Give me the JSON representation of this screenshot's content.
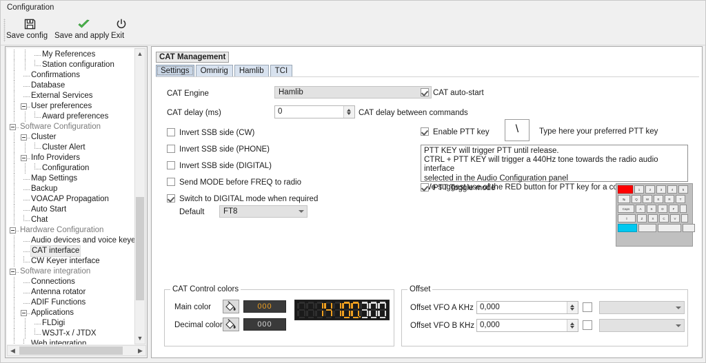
{
  "window": {
    "title": "Configuration"
  },
  "toolbar": {
    "save_config": "Save config",
    "save_and_apply": "Save and apply",
    "exit": "Exit"
  },
  "sidebar": {
    "items": [
      {
        "label": "My References",
        "depth": 3,
        "type": "leaf",
        "selected": false
      },
      {
        "label": "Station configuration",
        "depth": 3,
        "type": "last",
        "selected": false
      },
      {
        "label": "Confirmations",
        "depth": 2,
        "type": "leaf",
        "selected": false
      },
      {
        "label": "Database",
        "depth": 2,
        "type": "leaf",
        "selected": false
      },
      {
        "label": "External Services",
        "depth": 2,
        "type": "leaf",
        "selected": false
      },
      {
        "label": "User preferences",
        "depth": 2,
        "type": "exp",
        "selected": false
      },
      {
        "label": "Award preferences",
        "depth": 3,
        "type": "last",
        "selected": false
      },
      {
        "label": "Software Configuration",
        "depth": 1,
        "type": "exp",
        "selected": false,
        "group": true
      },
      {
        "label": "Cluster",
        "depth": 2,
        "type": "exp",
        "selected": false
      },
      {
        "label": "Cluster Alert",
        "depth": 3,
        "type": "last",
        "selected": false
      },
      {
        "label": "Info Providers",
        "depth": 2,
        "type": "exp",
        "selected": false
      },
      {
        "label": "Configuration",
        "depth": 3,
        "type": "last",
        "selected": false
      },
      {
        "label": "Map Settings",
        "depth": 2,
        "type": "leaf",
        "selected": false
      },
      {
        "label": "Backup",
        "depth": 2,
        "type": "leaf",
        "selected": false
      },
      {
        "label": "VOACAP Propagation",
        "depth": 2,
        "type": "leaf",
        "selected": false
      },
      {
        "label": "Auto Start",
        "depth": 2,
        "type": "leaf",
        "selected": false
      },
      {
        "label": "Chat",
        "depth": 2,
        "type": "last",
        "selected": false
      },
      {
        "label": "Hardware Configuration",
        "depth": 1,
        "type": "exp",
        "selected": false,
        "group": true
      },
      {
        "label": "Audio devices and voice keyer",
        "depth": 2,
        "type": "leaf",
        "selected": false
      },
      {
        "label": "CAT interface",
        "depth": 2,
        "type": "leaf",
        "selected": true
      },
      {
        "label": "CW Keyer interface",
        "depth": 2,
        "type": "last",
        "selected": false
      },
      {
        "label": "Software integration",
        "depth": 1,
        "type": "exp",
        "selected": false,
        "group": true
      },
      {
        "label": "Connections",
        "depth": 2,
        "type": "leaf",
        "selected": false
      },
      {
        "label": "Antenna rotator",
        "depth": 2,
        "type": "leaf",
        "selected": false
      },
      {
        "label": "ADIF Functions",
        "depth": 2,
        "type": "leaf",
        "selected": false
      },
      {
        "label": "Applications",
        "depth": 2,
        "type": "exp",
        "selected": false
      },
      {
        "label": "FLDigi",
        "depth": 3,
        "type": "leaf",
        "selected": false
      },
      {
        "label": "WSJT-x / JTDX",
        "depth": 3,
        "type": "last",
        "selected": false
      },
      {
        "label": "Web integration",
        "depth": 2,
        "type": "last",
        "selected": false
      }
    ]
  },
  "main": {
    "group_title": "CAT Management",
    "tabs": [
      {
        "label": "Settings",
        "active": true
      },
      {
        "label": "Omnirig",
        "active": false
      },
      {
        "label": "Hamlib",
        "active": false
      },
      {
        "label": "TCI",
        "active": false
      }
    ],
    "cat_engine_label": "CAT Engine",
    "cat_engine_value": "Hamlib",
    "cat_delay_label": "CAT delay (ms)",
    "cat_delay_value": "0",
    "cat_delay_hint": "CAT delay between commands",
    "cat_autostart_label": "CAT auto-start",
    "checks": [
      {
        "label": "Invert SSB side (CW)",
        "checked": false
      },
      {
        "label": "Invert SSB side (PHONE)",
        "checked": false
      },
      {
        "label": "Invert SSB side (DIGITAL)",
        "checked": false
      },
      {
        "label": "Send MODE before FREQ to radio",
        "checked": false
      },
      {
        "label": "Switch to DIGITAL mode when required",
        "checked": true
      }
    ],
    "default_label": "Default",
    "default_value": "FT8",
    "enable_ptt_label": "Enable PTT key",
    "ptt_key_value": "\\",
    "ptt_key_hint": "Type here your preferred PTT key",
    "ptt_help_lines": [
      "PTT KEY will trigger PTT until release.",
      "CTRL + PTT KEY will trigger a 440Hz tone towards the radio audio interface",
      "selected in the Audio Configuration panel",
      "We suggest use of the RED button for PTT key for a comfortable use"
    ],
    "ptt_toggle_label": "PTT Toggle mode",
    "keyboard": {
      "highlight_red": "#ff0000",
      "highlight_cyan": "#00c8f0",
      "rows": [
        [
          "",
          "1",
          "2",
          "3",
          "4",
          "5"
        ],
        [
          "↹",
          "Q",
          "W",
          "E",
          "R",
          "T"
        ],
        [
          "Caps",
          "A",
          "S",
          "D",
          "F",
          ""
        ],
        [
          "⇧",
          "Z",
          "X",
          "C",
          "V",
          ""
        ],
        [
          "",
          "",
          "",
          ""
        ]
      ]
    }
  },
  "cat_colors": {
    "caption": "CAT Control colors",
    "main_color_label": "Main color",
    "main_color_value": "000",
    "main_color_hex": "#f0a020",
    "decimal_color_label": "Decimal color",
    "decimal_color_value": "000",
    "decimal_color_hex": "#d8d8d8",
    "display_digits": "8814100300",
    "display_value": "14100.300",
    "display_active_from": 2,
    "display_decimal_from": 7,
    "display_dot_after": 6
  },
  "offset": {
    "caption": "Offset",
    "rows": [
      {
        "label": "Offset VFO A KHz",
        "value": "0,000",
        "checked": false,
        "combo_value": ""
      },
      {
        "label": "Offset VFO B KHz",
        "value": "0,000",
        "checked": false,
        "combo_value": ""
      }
    ]
  }
}
